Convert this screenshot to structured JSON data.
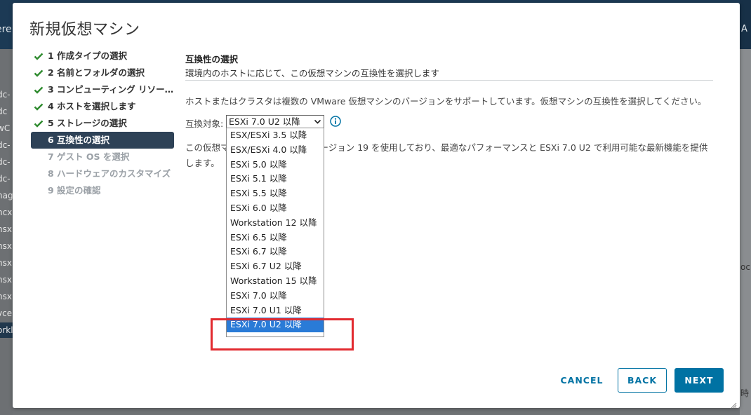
{
  "background": {
    "top_left_fragment": "ere",
    "top_right_fragment": "A",
    "left_items": [
      "dc-",
      "dc",
      "wC",
      "dc-",
      "dc-",
      "dc-",
      "nag",
      "ncx",
      "nsx",
      "nsx",
      "nsx",
      "nsx",
      "nsx",
      "vce",
      "orkl"
    ],
    "right_fragments": [
      "oc",
      "時"
    ]
  },
  "modal": {
    "title": "新規仮想マシン",
    "steps": [
      {
        "label": "1 作成タイプの選択",
        "state": "done"
      },
      {
        "label": "2 名前とフォルダの選択",
        "state": "done"
      },
      {
        "label": "3 コンピューティング リソー…",
        "state": "done"
      },
      {
        "label": "4 ホストを選択します",
        "state": "done"
      },
      {
        "label": "5 ストレージの選択",
        "state": "done"
      },
      {
        "label": "6 互換性の選択",
        "state": "active"
      },
      {
        "label": "7 ゲスト OS を選択",
        "state": "future"
      },
      {
        "label": "8 ハードウェアのカスタマイズ",
        "state": "future"
      },
      {
        "label": "9 設定の確認",
        "state": "future"
      }
    ],
    "section": {
      "title": "互換性の選択",
      "subtitle": "環境内のホストに応じて、この仮想マシンの互換性を選択します",
      "description": "ホストまたはクラスタは複数の VMware 仮想マシンのバージョンをサポートしています。仮想マシンの互換性を選択してください。",
      "compat_label": "互換対象:",
      "selected_value": "ESXi 7.0 U2 以降",
      "note": "この仮想マシンはハードウェア バージョン 19 を使用しており、最適なパフォーマンスと ESXi 7.0 U2 で利用可能な最新機能を提供します。"
    },
    "dropdown_options": [
      "ESX/ESXi 3.5 以降",
      "ESX/ESXi 4.0 以降",
      "ESXi 5.0 以降",
      "ESXi 5.1 以降",
      "ESXi 5.5 以降",
      "ESXi 6.0 以降",
      "Workstation 12 以降",
      "ESXi 6.5 以降",
      "ESXi 6.7 以降",
      "ESXi 6.7 U2 以降",
      "Workstation 15 以降",
      "ESXi 7.0 以降",
      "ESXi 7.0 U1 以降",
      "ESXi 7.0 U2 以降"
    ],
    "selected_option_index": 13,
    "buttons": {
      "cancel": "CANCEL",
      "back": "BACK",
      "next": "NEXT"
    },
    "colors": {
      "check": "#2f8b2f",
      "active_step": "#2e4257",
      "primary": "#0072a3",
      "selected_option": "#2a7bd7",
      "annotation": "#e22a2f"
    }
  }
}
